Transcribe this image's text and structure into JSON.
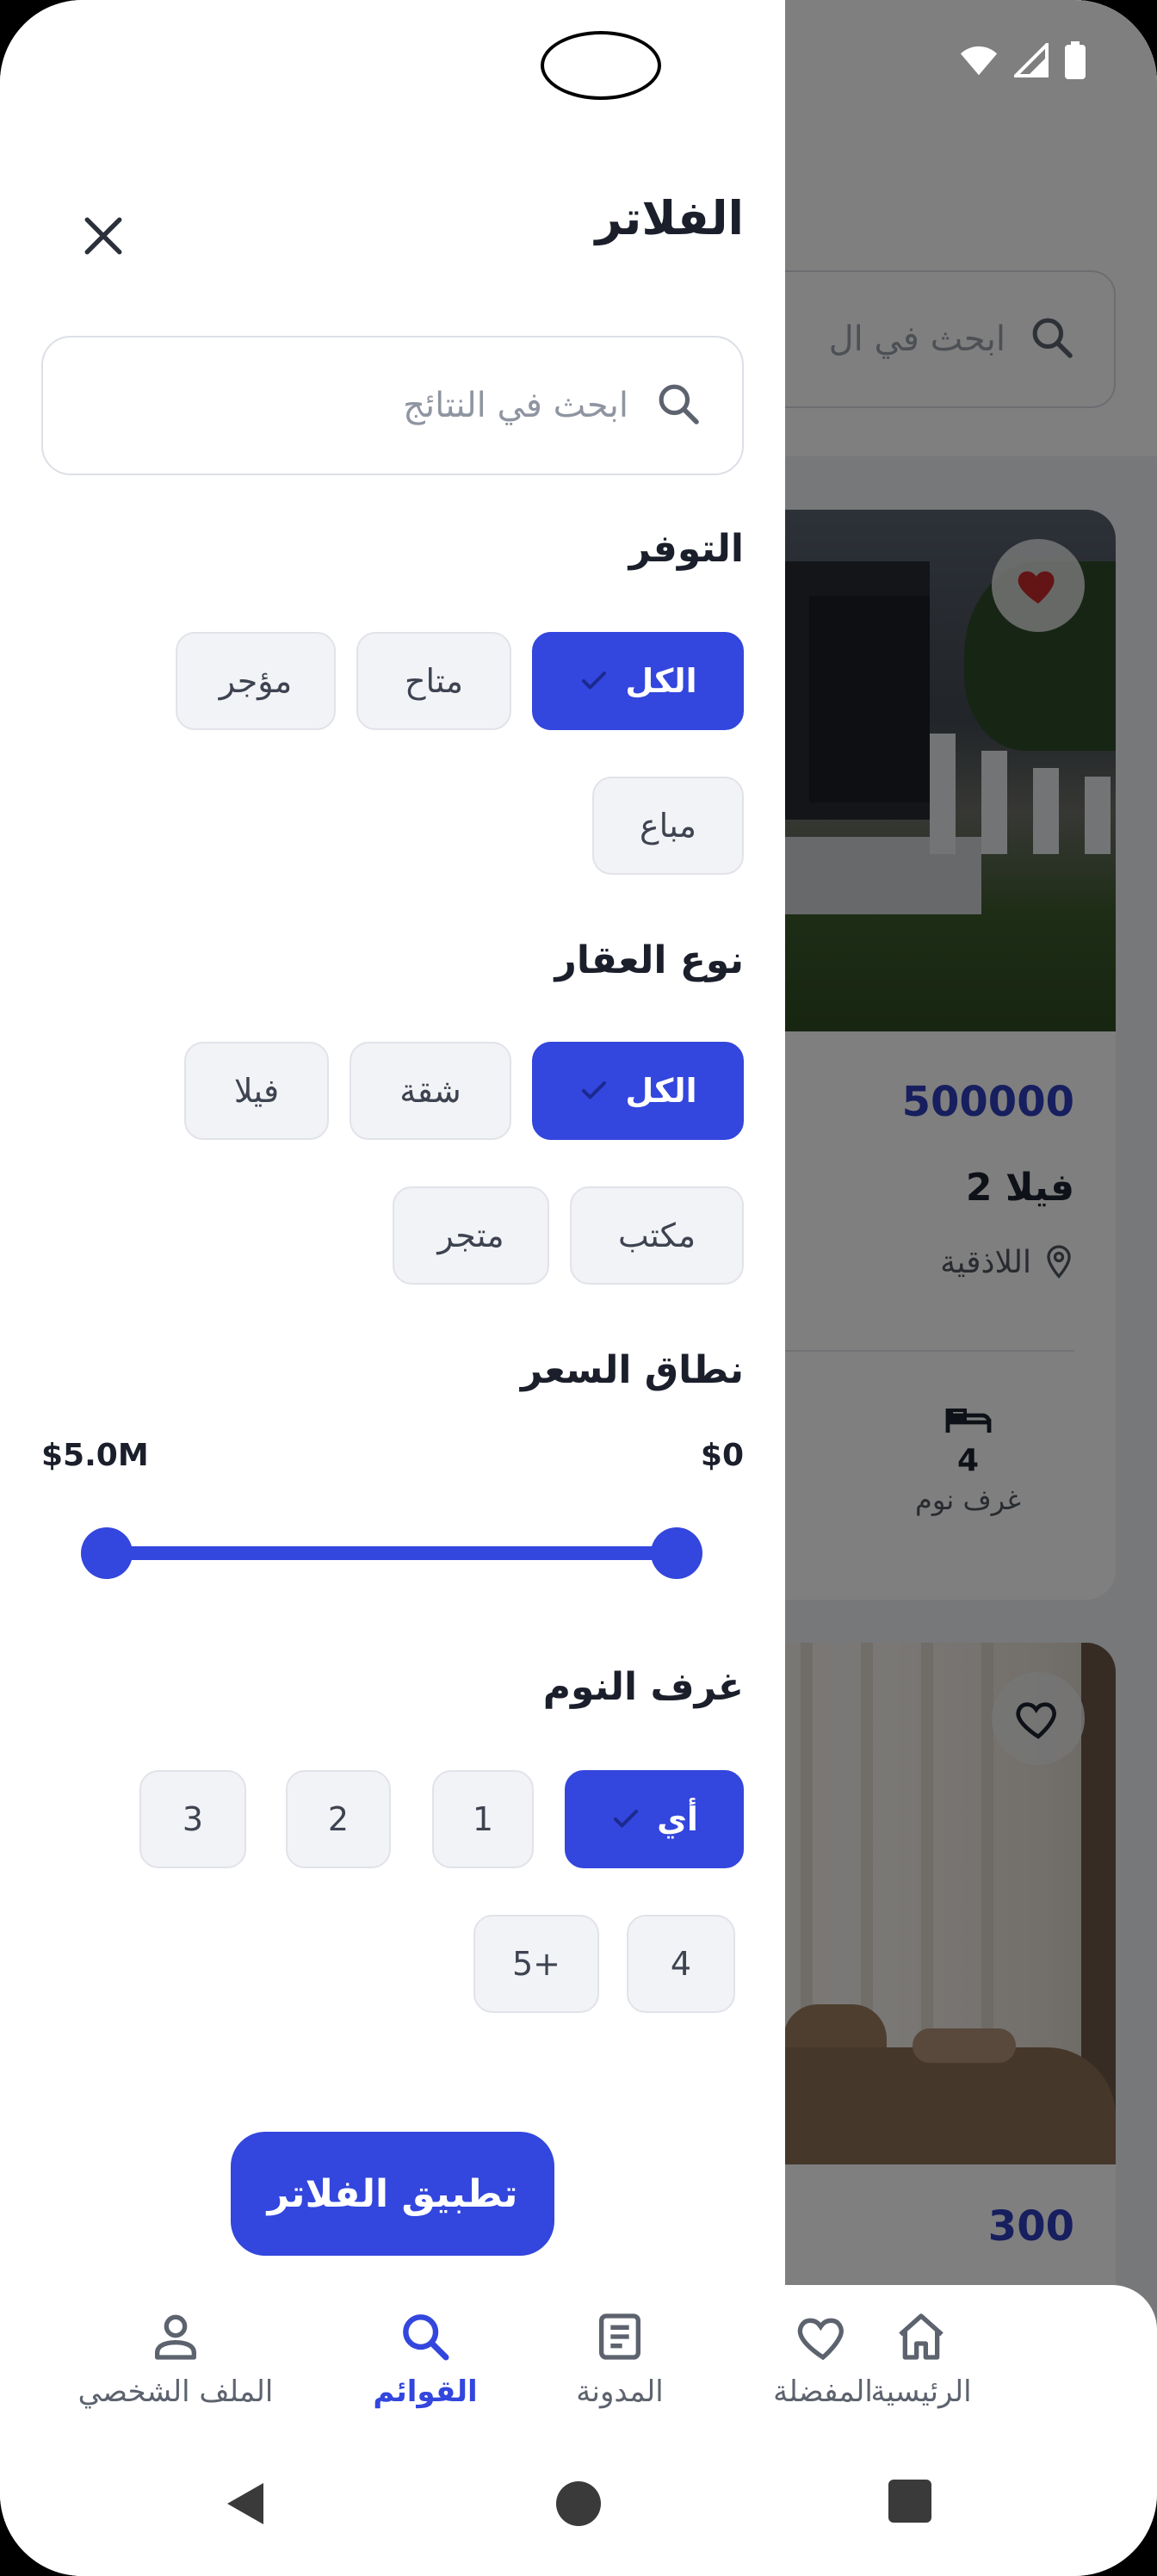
{
  "status_bar": {
    "icons": [
      "wifi-icon",
      "signal-icon",
      "battery-icon"
    ]
  },
  "background": {
    "search_placeholder": "ابحث في ال",
    "listing_1": {
      "price": "500000",
      "title": "فيلا 2",
      "location": "اللاذقية",
      "bedrooms": "4",
      "bedrooms_label": "غرف نوم",
      "favorited": true
    },
    "listing_2": {
      "price": "300",
      "favorited": false
    }
  },
  "drawer": {
    "title": "الفلاتر",
    "search_placeholder": "ابحث في النتائج",
    "availability": {
      "heading": "التوفر",
      "options": [
        "الكل",
        "متاح",
        "مؤجر",
        "مباع"
      ],
      "selected": "الكل"
    },
    "property_type": {
      "heading": "نوع العقار",
      "options": [
        "الكل",
        "شقة",
        "فيلا",
        "مكتب",
        "متجر"
      ],
      "selected": "الكل"
    },
    "price_range": {
      "heading": "نطاق السعر",
      "min_label": "$0",
      "max_label": "$5.0M",
      "min_fraction": 0,
      "max_fraction": 1
    },
    "bedrooms": {
      "heading": "غرف النوم",
      "options": [
        "أي",
        "1",
        "2",
        "3",
        "4",
        "5+"
      ],
      "selected": "أي"
    },
    "apply_label": "تطبيق الفلاتر"
  },
  "bottom_nav": {
    "items": [
      {
        "label": "الرئيسية",
        "icon": "home-icon"
      },
      {
        "label": "المفضلة",
        "icon": "heart-icon"
      },
      {
        "label": "المدونة",
        "icon": "article-icon"
      },
      {
        "label": "القوائم",
        "icon": "search-icon",
        "active": true
      },
      {
        "label": "الملف الشخصي",
        "icon": "person-icon"
      }
    ]
  },
  "colors": {
    "accent": "#3346dd",
    "price": "#2f3fbf",
    "heart_active": "#c62828"
  }
}
